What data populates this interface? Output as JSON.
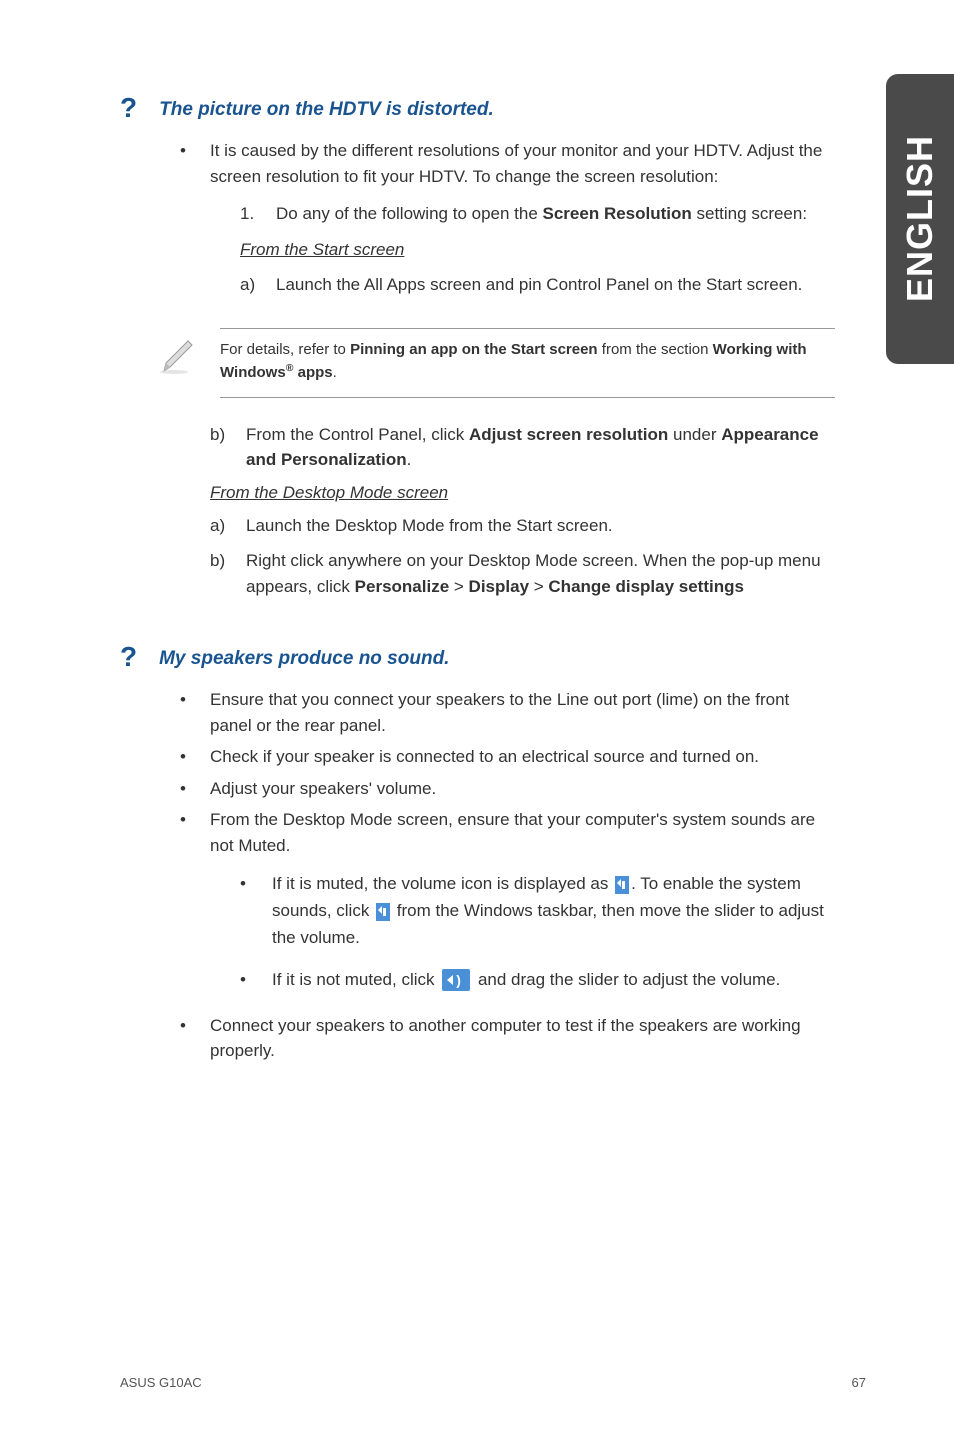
{
  "sideTab": "ENGLISH",
  "q1": {
    "title": "The picture on the HDTV is distorted.",
    "mainBullet": "It is caused by the different resolutions of your monitor and your HDTV. Adjust the screen resolution to fit your HDTV. To change the screen resolution:",
    "step1_prefix": "Do any of the following to open the ",
    "step1_bold": "Screen Resolution",
    "step1_suffix": " setting screen:",
    "fromStart": "From the Start screen",
    "stepA": "Launch the All Apps screen and pin Control Panel on the Start screen.",
    "note_prefix": "For details, refer to ",
    "note_bold1": "Pinning an app on the Start screen",
    "note_mid": " from the section ",
    "note_bold2_pre": "Working with Windows",
    "note_bold2_sup": "®",
    "note_bold2_suf": " apps",
    "stepB_prefix": "From the Control Panel, click ",
    "stepB_bold1": "Adjust screen resolution",
    "stepB_mid": " under ",
    "stepB_bold2": "Appearance and Personalization",
    "fromDesktop": "From the Desktop Mode screen",
    "desktopA": "Launch the Desktop Mode from the Start screen.",
    "desktopB_prefix": "Right click anywhere on your Desktop Mode screen. When the pop-up menu appears, click ",
    "desktopB_b1": "Personalize",
    "desktopB_b2": "Display",
    "desktopB_b3": "Change display settings"
  },
  "q2": {
    "title": "My speakers produce no sound.",
    "b1": "Ensure that you connect your speakers to the Line out port (lime) on the front panel or the rear panel.",
    "b2": "Check if your speaker is connected to an electrical source and turned on.",
    "b3": "Adjust your speakers' volume.",
    "b4": "From the Desktop Mode screen, ensure that your computer's system sounds are not Muted.",
    "sub1_a": "If it is muted, the volume icon is displayed as ",
    "sub1_b": ". To enable the system sounds, click ",
    "sub1_c": " from the Windows taskbar, then move the slider to adjust the volume.",
    "sub2_a": "If it is not muted, click ",
    "sub2_b": " and drag the slider to adjust the volume.",
    "b5": "Connect your speakers to another computer to test if the speakers are working properly."
  },
  "footer": {
    "left": "ASUS G10AC",
    "right": "67"
  }
}
